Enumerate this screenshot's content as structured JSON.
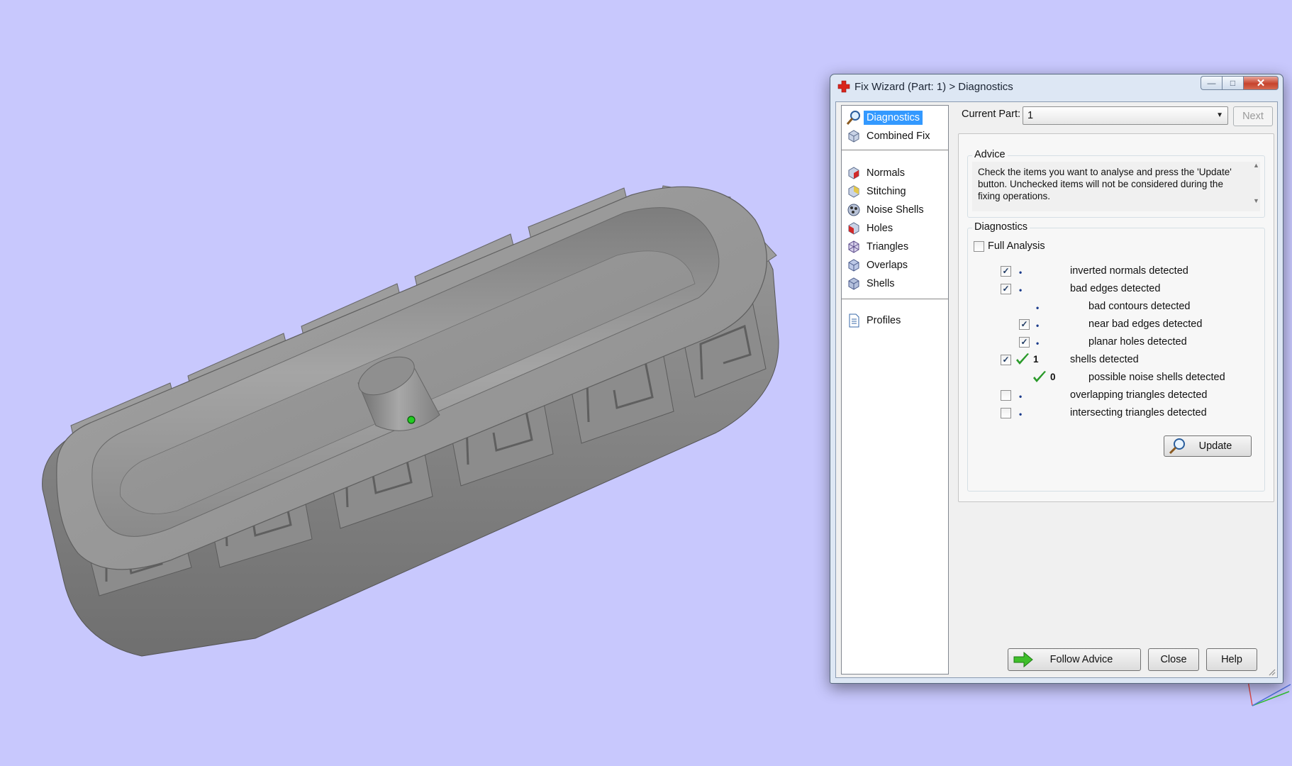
{
  "window": {
    "title": "Fix Wizard (Part: 1) > Diagnostics",
    "minimize_symbol": "—",
    "maximize_symbol": "□",
    "close_symbol": "✕"
  },
  "sidebar": {
    "top_items": [
      {
        "label": "Diagnostics",
        "icon": "magnifier-icon",
        "selected": true
      },
      {
        "label": "Combined Fix",
        "icon": "cube-icon"
      }
    ],
    "tool_items": [
      {
        "label": "Normals",
        "icon": "normals-cube-icon"
      },
      {
        "label": "Stitching",
        "icon": "stitching-cube-icon"
      },
      {
        "label": "Noise Shells",
        "icon": "noise-shells-icon"
      },
      {
        "label": "Holes",
        "icon": "holes-cube-icon"
      },
      {
        "label": "Triangles",
        "icon": "triangles-icon"
      },
      {
        "label": "Overlaps",
        "icon": "overlaps-cube-icon"
      },
      {
        "label": "Shells",
        "icon": "shells-cube-icon"
      }
    ],
    "bottom_items": [
      {
        "label": "Profiles",
        "icon": "document-icon"
      }
    ]
  },
  "current_part": {
    "label": "Current Part:",
    "value": "1",
    "next_label": "Next"
  },
  "advice": {
    "title": "Advice",
    "text": "Check the items you want to analyse and press the 'Update' button. Unchecked items will not be considered during the fixing operations."
  },
  "diagnostics": {
    "title": "Diagnostics",
    "full_analysis_label": "Full Analysis",
    "full_analysis_checked": false,
    "rows": [
      {
        "label": "inverted normals detected",
        "checked": true,
        "has_checkbox": true,
        "indent": 0,
        "status": "dot",
        "count": ""
      },
      {
        "label": "bad edges detected",
        "checked": true,
        "has_checkbox": true,
        "indent": 0,
        "status": "dot",
        "count": ""
      },
      {
        "label": "bad contours detected",
        "checked": false,
        "has_checkbox": false,
        "indent": 1,
        "status": "dot",
        "count": ""
      },
      {
        "label": "near bad edges detected",
        "checked": true,
        "has_checkbox": true,
        "indent": 1,
        "status": "dot",
        "count": ""
      },
      {
        "label": "planar holes detected",
        "checked": true,
        "has_checkbox": true,
        "indent": 1,
        "status": "dot",
        "count": ""
      },
      {
        "label": "shells detected",
        "checked": true,
        "has_checkbox": true,
        "indent": 0,
        "status": "ok",
        "count": "1"
      },
      {
        "label": "possible noise shells detected",
        "checked": false,
        "has_checkbox": false,
        "indent": 1,
        "status": "ok",
        "count": "0"
      },
      {
        "label": "overlapping triangles detected",
        "checked": false,
        "has_checkbox": true,
        "indent": 0,
        "status": "dot",
        "count": ""
      },
      {
        "label": "intersecting triangles detected",
        "checked": false,
        "has_checkbox": true,
        "indent": 0,
        "status": "dot",
        "count": ""
      }
    ],
    "update_label": "Update"
  },
  "footer": {
    "follow_advice_label": "Follow Advice",
    "close_label": "Close",
    "help_label": "Help"
  },
  "colors": {
    "viewport_bg": "#c8c8fd",
    "model_gray": "#8a8a8a",
    "selection_blue": "#3399ff",
    "check_green": "#2a9a2a",
    "dot_blue": "#1c3c8c",
    "titlebar_bg": "#dde7f4"
  }
}
